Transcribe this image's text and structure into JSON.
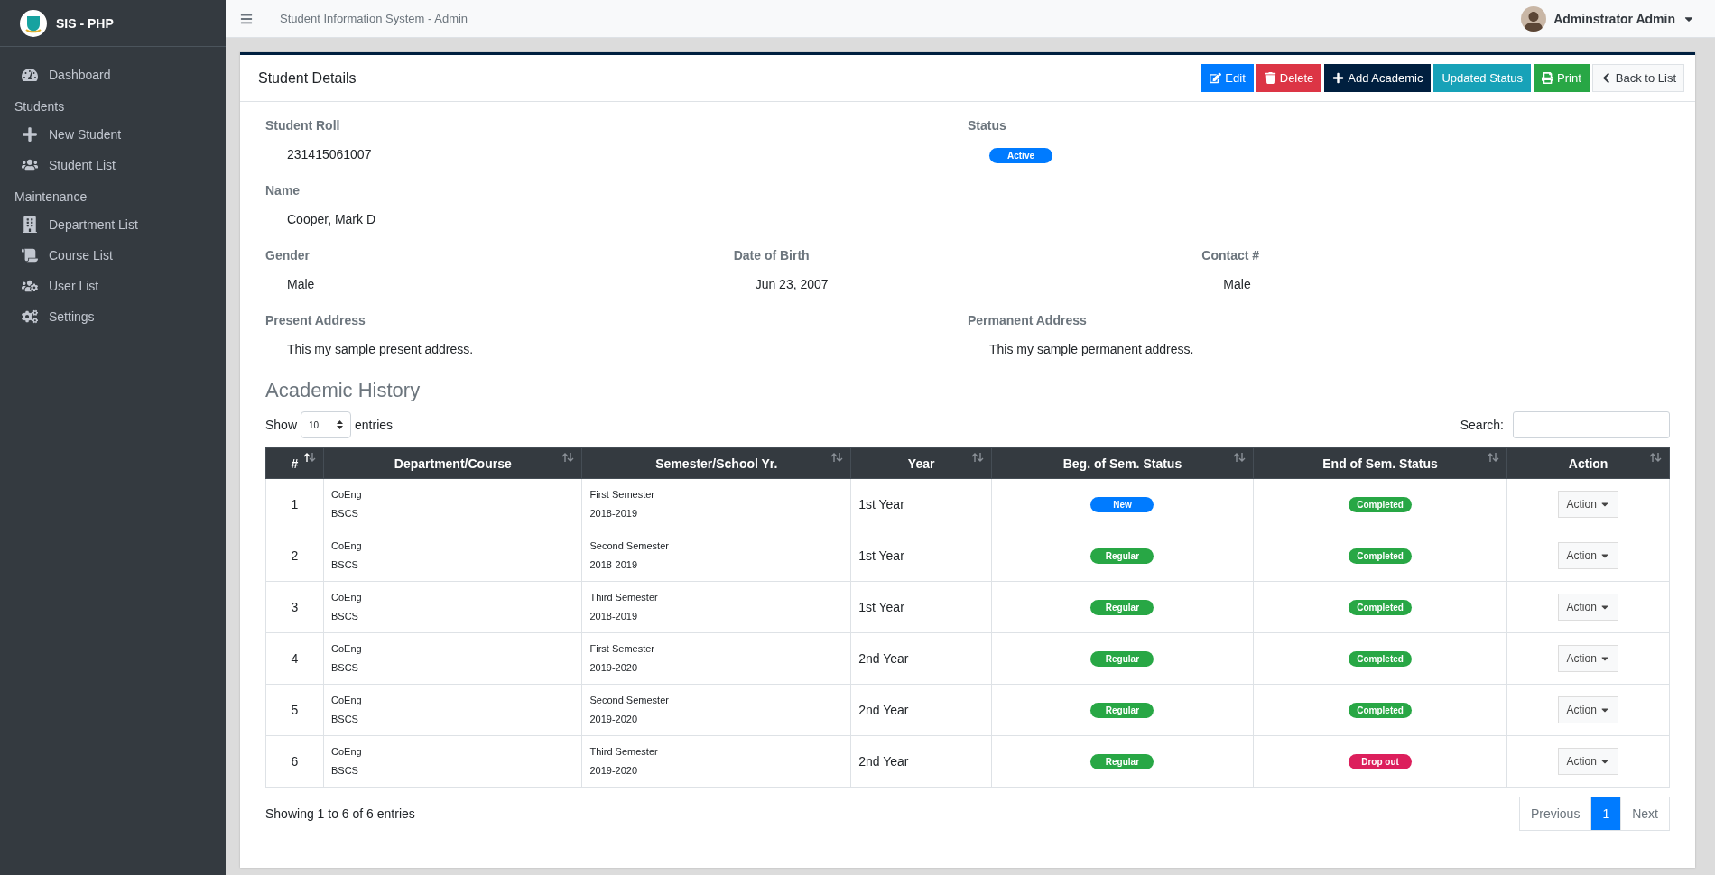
{
  "brand": {
    "title": "SIS - PHP"
  },
  "sidebar": {
    "sections": [
      {
        "items": [
          {
            "kind": "dashboard",
            "label": "Dashboard"
          }
        ]
      },
      {
        "heading": "Students",
        "items": [
          {
            "kind": "plus",
            "label": "New Student"
          },
          {
            "kind": "users",
            "label": "Student List"
          }
        ]
      },
      {
        "heading": "Maintenance",
        "items": [
          {
            "kind": "building",
            "label": "Department List"
          },
          {
            "kind": "scroll",
            "label": "Course List"
          },
          {
            "kind": "usergear",
            "label": "User List"
          },
          {
            "kind": "gears",
            "label": "Settings"
          }
        ]
      }
    ]
  },
  "header": {
    "title": "Student Information System - Admin",
    "user": "Adminstrator Admin"
  },
  "card": {
    "title": "Student Details",
    "buttons": [
      {
        "kind": "edit",
        "label": "Edit",
        "color": "#007bff"
      },
      {
        "kind": "delete",
        "label": "Delete",
        "color": "#dc3545"
      },
      {
        "kind": "add",
        "label": "Add Academic",
        "color": "#001f3f"
      },
      {
        "kind": "plain",
        "label": "Updated Status",
        "color": "#17a2b8"
      },
      {
        "kind": "print",
        "label": "Print",
        "color": "#28a745"
      },
      {
        "kind": "back",
        "label": "Back to List",
        "color": "#f8f9fa"
      }
    ]
  },
  "details": {
    "student_roll": {
      "label": "Student Roll",
      "value": "231415061007"
    },
    "status": {
      "label": "Status",
      "value": "Active",
      "color": "#007bff"
    },
    "name": {
      "label": "Name",
      "value": "Cooper, Mark D"
    },
    "gender": {
      "label": "Gender",
      "value": "Male"
    },
    "date_of_birth": {
      "label": "Date of Birth",
      "value": "Jun 23, 2007"
    },
    "contact": {
      "label": "Contact #",
      "value": "Male"
    },
    "present_address": {
      "label": "Present Address",
      "value": "This my sample present address."
    },
    "permanent_address": {
      "label": "Permanent Address",
      "value": "This my sample permanent address."
    }
  },
  "academic_history": {
    "title": "Academic History",
    "show_label": "Show",
    "page_size": "10",
    "entries_label": "entries",
    "search_label": "Search:",
    "table": {
      "columns": [
        {
          "label": "#",
          "sorted": true
        },
        {
          "label": "Department/Course",
          "sorted": false
        },
        {
          "label": "Semester/School Yr.",
          "sorted": false
        },
        {
          "label": "Year",
          "sorted": false
        },
        {
          "label": "Beg. of Sem. Status",
          "sorted": false
        },
        {
          "label": "End of Sem. Status",
          "sorted": false
        },
        {
          "label": "Action",
          "sorted": false
        }
      ],
      "rows": [
        {
          "num": "1",
          "department": "CoEng",
          "course": "BSCS",
          "semester": "First Semester",
          "school_year": "2018-2019",
          "year": "1st Year",
          "beg_status": {
            "label": "New",
            "color": "#007bff"
          },
          "end_status": {
            "label": "Completed",
            "color": "#28a745"
          },
          "action": "Action"
        },
        {
          "num": "2",
          "department": "CoEng",
          "course": "BSCS",
          "semester": "Second Semester",
          "school_year": "2018-2019",
          "year": "1st Year",
          "beg_status": {
            "label": "Regular",
            "color": "#28a745"
          },
          "end_status": {
            "label": "Completed",
            "color": "#28a745"
          },
          "action": "Action"
        },
        {
          "num": "3",
          "department": "CoEng",
          "course": "BSCS",
          "semester": "Third Semester",
          "school_year": "2018-2019",
          "year": "1st Year",
          "beg_status": {
            "label": "Regular",
            "color": "#28a745"
          },
          "end_status": {
            "label": "Completed",
            "color": "#28a745"
          },
          "action": "Action"
        },
        {
          "num": "4",
          "department": "CoEng",
          "course": "BSCS",
          "semester": "First Semester",
          "school_year": "2019-2020",
          "year": "2nd Year",
          "beg_status": {
            "label": "Regular",
            "color": "#28a745"
          },
          "end_status": {
            "label": "Completed",
            "color": "#28a745"
          },
          "action": "Action"
        },
        {
          "num": "5",
          "department": "CoEng",
          "course": "BSCS",
          "semester": "Second Semester",
          "school_year": "2019-2020",
          "year": "2nd Year",
          "beg_status": {
            "label": "Regular",
            "color": "#28a745"
          },
          "end_status": {
            "label": "Completed",
            "color": "#28a745"
          },
          "action": "Action"
        },
        {
          "num": "6",
          "department": "CoEng",
          "course": "BSCS",
          "semester": "Third Semester",
          "school_year": "2019-2020",
          "year": "2nd Year",
          "beg_status": {
            "label": "Regular",
            "color": "#28a745"
          },
          "end_status": {
            "label": "Drop out",
            "color": "#dc1f5c"
          },
          "action": "Action"
        }
      ]
    },
    "info": "Showing 1 to 6 of 6 entries",
    "pagination": [
      {
        "label": "Previous",
        "selected": false
      },
      {
        "label": "1",
        "selected": true
      },
      {
        "label": "Next",
        "selected": false
      }
    ]
  }
}
